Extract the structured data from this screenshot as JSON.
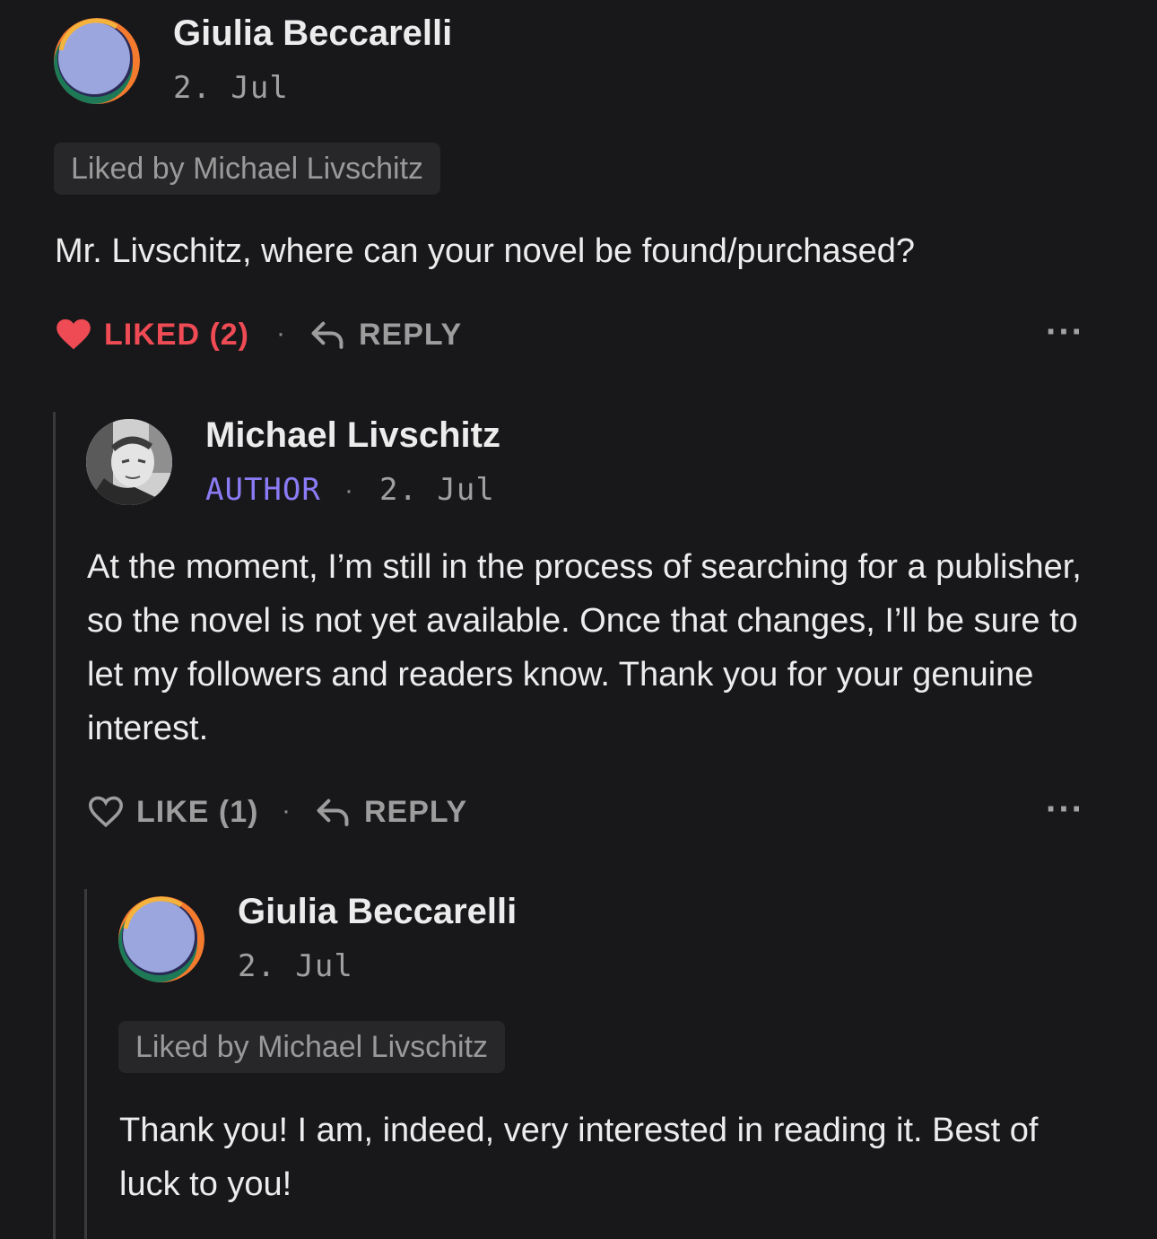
{
  "comments": [
    {
      "author": "Giulia Beccarelli",
      "date": "2. Jul",
      "liked_by": "Liked by Michael Livschitz",
      "text": "Mr. Livschitz, where can your novel be found/purchased?",
      "like_label": "LIKED (2)",
      "like_state": "liked",
      "reply_label": "REPLY",
      "more": "···"
    },
    {
      "author": "Michael Livschitz",
      "role": "AUTHOR",
      "date": "2. Jul",
      "text": "At the moment, I’m still in the process of searching for a publisher, so the novel is not yet available. Once that changes, I’ll be sure to let my followers and readers know. Thank you for your genuine interest.",
      "like_label": "LIKE (1)",
      "like_state": "not-liked",
      "reply_label": "REPLY",
      "more": "···"
    },
    {
      "author": "Giulia Beccarelli",
      "date": "2. Jul",
      "liked_by": "Liked by Michael Livschitz",
      "text": "Thank you! I am, indeed, very interested in reading it. Best of luck to you!"
    }
  ],
  "separator": "·",
  "colors": {
    "background": "#18181b",
    "liked": "#ef4b54",
    "author_badge": "#8b7cf6",
    "badge_bg": "#27272a"
  },
  "icons": {
    "heart_filled": "heart-filled-icon",
    "heart_outline": "heart-outline-icon",
    "reply": "reply-arrow-icon",
    "more": "more-dots-icon"
  }
}
